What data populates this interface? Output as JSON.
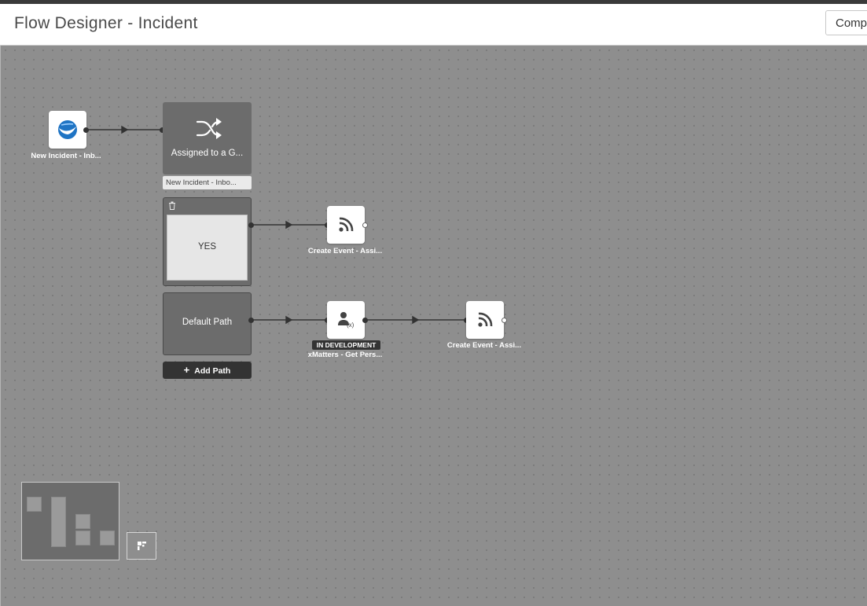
{
  "header": {
    "title": "Flow Designer - Incident",
    "action_label": "Comp"
  },
  "nodes": {
    "trigger": {
      "label": "New Incident - Inb...",
      "icon": "servicenow-globe-icon"
    },
    "decision": {
      "title": "Assigned to a G...",
      "subtitle": "New Incident - Inbo...",
      "icon": "shuffle-icon"
    },
    "yes_branch": {
      "label": "YES"
    },
    "default_branch": {
      "label": "Default Path"
    },
    "add_path": {
      "label": "Add Path"
    },
    "create_event_1": {
      "label": "Create Event - Assi...",
      "icon": "rss-icon"
    },
    "xmatters_get": {
      "label": "xMatters - Get Pers...",
      "badge": "IN DEVELOPMENT",
      "icon": "person-variable-icon"
    },
    "create_event_2": {
      "label": "Create Event - Assi...",
      "icon": "rss-icon"
    }
  },
  "colors": {
    "canvas": "#8e8e8e",
    "decision": "#6c6c6c",
    "accent": "#1f74c4"
  }
}
